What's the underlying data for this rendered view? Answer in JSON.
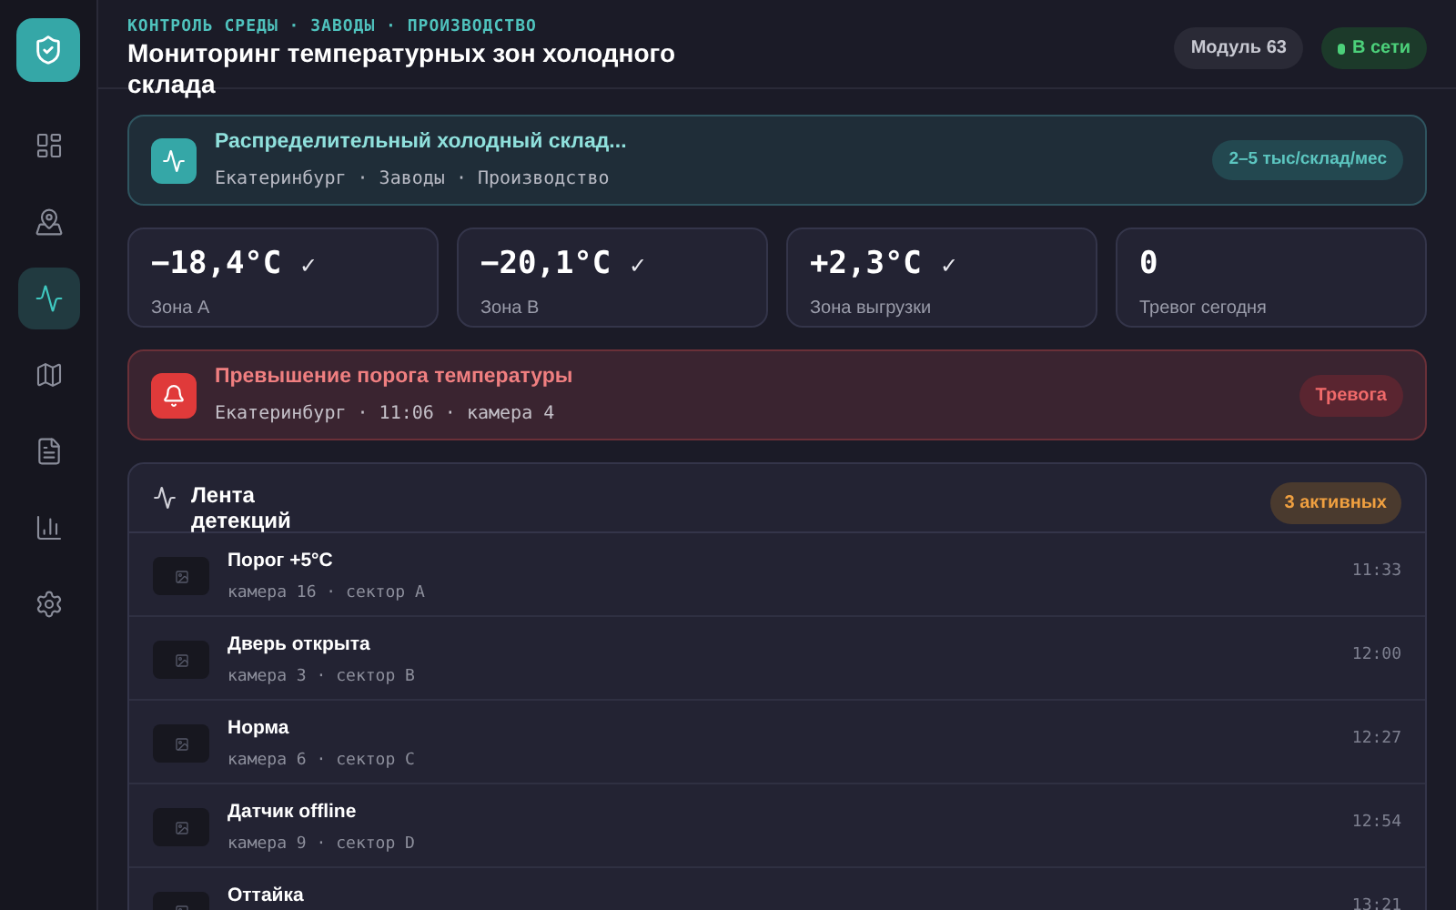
{
  "sidebar": {
    "items": [
      {
        "kind": "dashboard",
        "selected": false
      },
      {
        "kind": "photo-map",
        "selected": false
      },
      {
        "kind": "activity",
        "selected": true
      },
      {
        "kind": "map",
        "selected": false
      },
      {
        "kind": "document",
        "selected": false
      },
      {
        "kind": "chart",
        "selected": false
      },
      {
        "kind": "settings",
        "selected": false
      }
    ]
  },
  "header": {
    "breadcrumb": "КОНТРОЛЬ СРЕДЫ · ЗАВОДЫ · ПРОИЗВОДСТВО",
    "title": "Мониторинг температурных зон холодного склада",
    "module": "Модуль 63",
    "status": "В сети"
  },
  "site": {
    "name": "Распределительный холодный склад...",
    "location": "Екатеринбург · Заводы · Производство",
    "price": "2–5 тыс/склад/мес"
  },
  "stats": [
    {
      "value": "−18,4°C",
      "ok": true,
      "label": "Зона A"
    },
    {
      "value": "−20,1°C",
      "ok": true,
      "label": "Зона B"
    },
    {
      "value": "+2,3°C",
      "ok": true,
      "label": "Зона выгрузки"
    },
    {
      "value": "0",
      "ok": false,
      "label": "Тревог сегодня"
    }
  ],
  "check_mark": "✓",
  "alert": {
    "title": "Превышение порога температуры",
    "details": "Екатеринбург · 11:06 · камера 4",
    "badge": "Тревога"
  },
  "feed": {
    "title": "Лента детекций",
    "badge": "3 активных",
    "rows": [
      {
        "title": "Порог +5°C",
        "details": "камера 16 · сектор A",
        "time": "11:33"
      },
      {
        "title": "Дверь открыта",
        "details": "камера 3 · сектор B",
        "time": "12:00"
      },
      {
        "title": "Норма",
        "details": "камера 6 · сектор C",
        "time": "12:27"
      },
      {
        "title": "Датчик offline",
        "details": "камера 9 · сектор D",
        "time": "12:54"
      },
      {
        "title": "Оттайка",
        "time": "13:21"
      }
    ]
  }
}
